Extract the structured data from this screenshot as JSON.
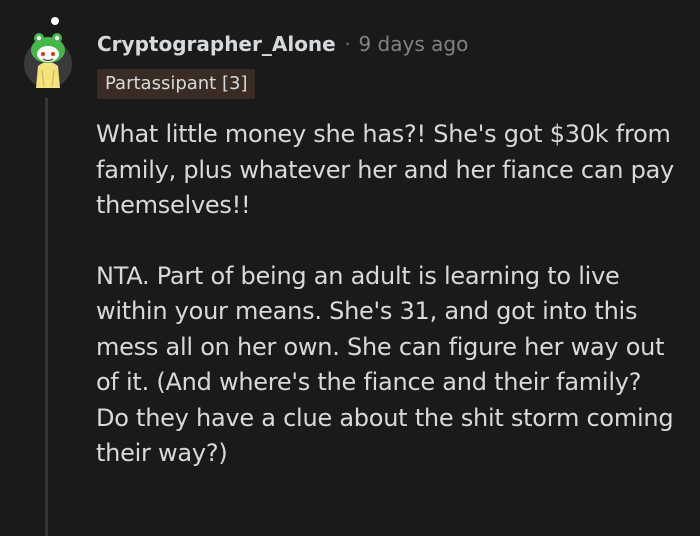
{
  "comment": {
    "username": "Cryptographer_Alone",
    "separator": "·",
    "timestamp": "9 days ago",
    "flair": "Partassipant [3]",
    "paragraphs": [
      "What little money she has?! She's got $30k from family, plus whatever her and her fiance can pay themselves!!",
      "NTA. Part of being an adult is learning to live within your means. She's 31, and got into this mess all on her own. She can figure her way out of it. (And where's the fiance and their family? Do they have a clue about the shit storm coming their way?)"
    ]
  },
  "avatar": {
    "icon": "snoo-avatar-icon",
    "background_color": "#3a3a3c",
    "helmet_color": "#46b84a",
    "body_color": "#f5e27a"
  },
  "colors": {
    "page_background": "#1a1a1b",
    "text": "#d7dadc",
    "meta_text": "#818384",
    "flair_background": "#3a2b25",
    "thread_line": "#343536"
  }
}
